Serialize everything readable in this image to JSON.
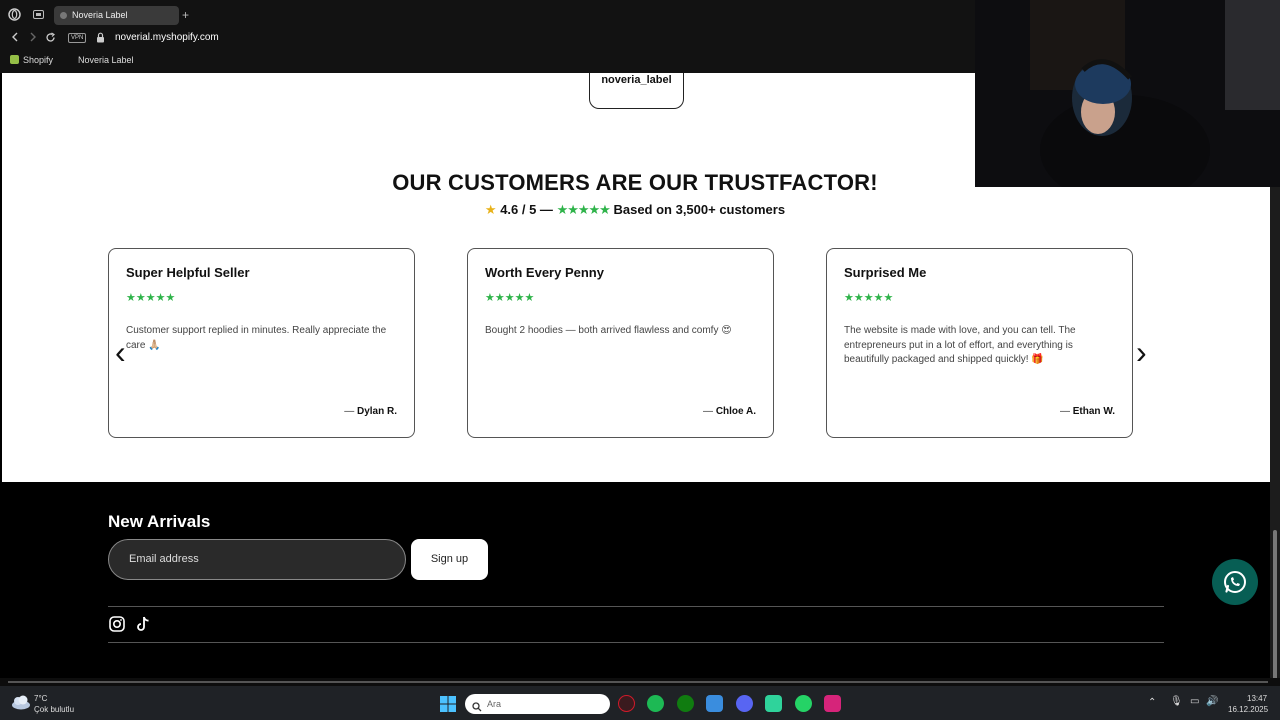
{
  "browser": {
    "tab_title": "Noveria Label",
    "new_tab": "+",
    "vpn_badge": "VPN",
    "url_host": "noverial.myshopify.com",
    "bookmarks": [
      "Shopify",
      "Noveria Label"
    ]
  },
  "page": {
    "instagram_handle": "noveria_label",
    "heading": "OUR CUSTOMERS ARE OUR TRUSTFACTOR!",
    "rating_score": "4.6 / 5 —",
    "rating_stars": "★★★★★",
    "rating_text": "Based on 3,500+ customers",
    "reviews": [
      {
        "title": "Super Helpful Seller",
        "stars": "★★★★★",
        "body": "Customer support replied in minutes. Really appreciate the care 🙏🏼",
        "author": "Dylan R."
      },
      {
        "title": "Worth Every Penny",
        "stars": "★★★★★",
        "body": "Bought 2 hoodies — both arrived flawless and comfy 😍",
        "author": "Chloe A."
      },
      {
        "title": "Surprised Me",
        "stars": "★★★★★",
        "body": "The website is made with love, and you can tell. The entrepreneurs put in a lot of effort, and everything is beautifully packaged and shipped quickly! 🎁",
        "author": "Ethan W."
      }
    ],
    "author_prefix": "—",
    "prev_arrow": "‹",
    "next_arrow": "›"
  },
  "footer": {
    "title": "New Arrivals",
    "email_placeholder": "Email address",
    "signup_label": "Sign up",
    "social_icons": [
      "instagram-icon",
      "tiktok-icon"
    ]
  },
  "taskbar": {
    "temperature": "7°C",
    "weather": "Çok bulutlu",
    "search_placeholder": "Ara",
    "time": "13:47",
    "date": "16.12.2025"
  },
  "colors": {
    "star_green": "#2fb34a",
    "whatsapp": "#075e54"
  }
}
